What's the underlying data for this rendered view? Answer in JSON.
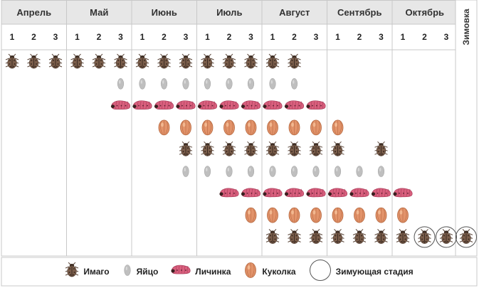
{
  "colors": {
    "header_bg": "#e7e7e7",
    "grid_line": "#c8c8c8",
    "beetle": "#5a4538",
    "egg": "#bfbfbf",
    "larva": "#d9607e",
    "pupa": "#e2936a"
  },
  "months": [
    "Апрель",
    "Май",
    "Июнь",
    "Июль",
    "Август",
    "Сентябрь",
    "Октябрь"
  ],
  "decades": [
    "1",
    "2",
    "3"
  ],
  "winter_label": "Зимовка",
  "stages": {
    "imago": "Имаго",
    "egg": "Яйцо",
    "larva": "Личинка",
    "pupa": "Куколка",
    "overwinter": "Зимующая стадия"
  },
  "chart_data": {
    "type": "table",
    "rows": [
      {
        "stage": "imago",
        "columns": [
          1,
          2,
          3,
          4,
          5,
          6,
          7,
          8,
          9,
          10,
          11,
          12,
          13,
          14
        ]
      },
      {
        "stage": "egg",
        "columns": [
          6,
          7,
          8,
          9,
          10,
          11,
          12,
          13,
          14
        ]
      },
      {
        "stage": "larva",
        "columns": [
          6,
          7,
          8,
          9,
          10,
          11,
          12,
          13,
          14,
          15
        ]
      },
      {
        "stage": "pupa",
        "columns": [
          8,
          9,
          10,
          11,
          12,
          13,
          14,
          15,
          16
        ]
      },
      {
        "stage": "imago",
        "columns": [
          9,
          10,
          11,
          12,
          13,
          14,
          15,
          16,
          18
        ]
      },
      {
        "stage": "egg",
        "columns": [
          9,
          10,
          11,
          12,
          13,
          14,
          15,
          16,
          17,
          18
        ]
      },
      {
        "stage": "larva",
        "columns": [
          11,
          12,
          13,
          14,
          15,
          16,
          17,
          18,
          19
        ]
      },
      {
        "stage": "pupa",
        "columns": [
          12,
          13,
          14,
          15,
          16,
          17,
          18,
          19
        ]
      },
      {
        "stage": "imago",
        "columns": [
          13,
          14,
          15,
          16,
          17,
          18,
          19,
          20,
          21,
          22
        ]
      }
    ],
    "overwinter_columns": [
      20,
      21,
      22
    ],
    "overwinter_stage": "imago"
  }
}
